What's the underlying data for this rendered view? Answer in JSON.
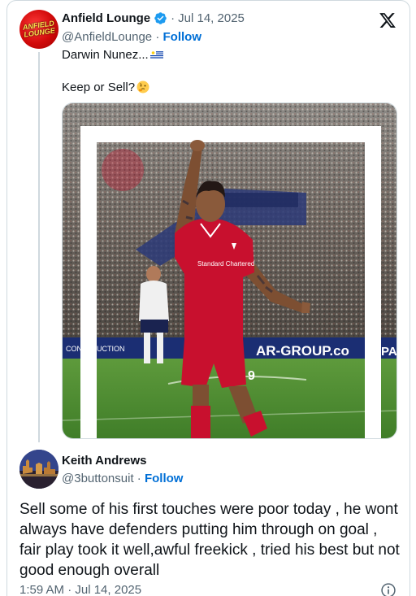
{
  "tweet": {
    "author_name": "Anfield Lounge",
    "avatar_text": "ANFIELD LOUNGE",
    "date": "Jul 14, 2025",
    "date_sep": "·",
    "handle": "@AnfieldLounge",
    "handle_sep": "·",
    "follow_label": "Follow",
    "line1": "Darwin Nunez...",
    "line2": "Keep or Sell?",
    "flag_icon": "uruguay-flag-icon",
    "thinking_icon": "thinking-face-icon",
    "media_description_watermark": "",
    "jersey_number": "9",
    "sponsor_text": "Standard Chartered",
    "board_text_1": "AR-GROUP.co",
    "board_text_2": "CONSTRUCTION",
    "board_text_3": "PA"
  },
  "reply": {
    "author_name": "Keith Andrews",
    "handle": "@3buttonsuit",
    "handle_sep": "·",
    "follow_label": "Follow",
    "text": "Sell some of his first touches were poor today , he wont always have defenders putting him through on goal , fair play took it well,awful freekick , tried his best but not good enough overall",
    "timestamp": "1:59 AM · Jul 14, 2025"
  },
  "colors": {
    "accent": "#006fd6",
    "verified": "#1d9bf0",
    "muted": "#536471",
    "border": "#cfd9de",
    "kit_red": "#c8102e"
  },
  "icons": [
    "verified-badge-icon",
    "x-logo-icon",
    "info-icon"
  ]
}
